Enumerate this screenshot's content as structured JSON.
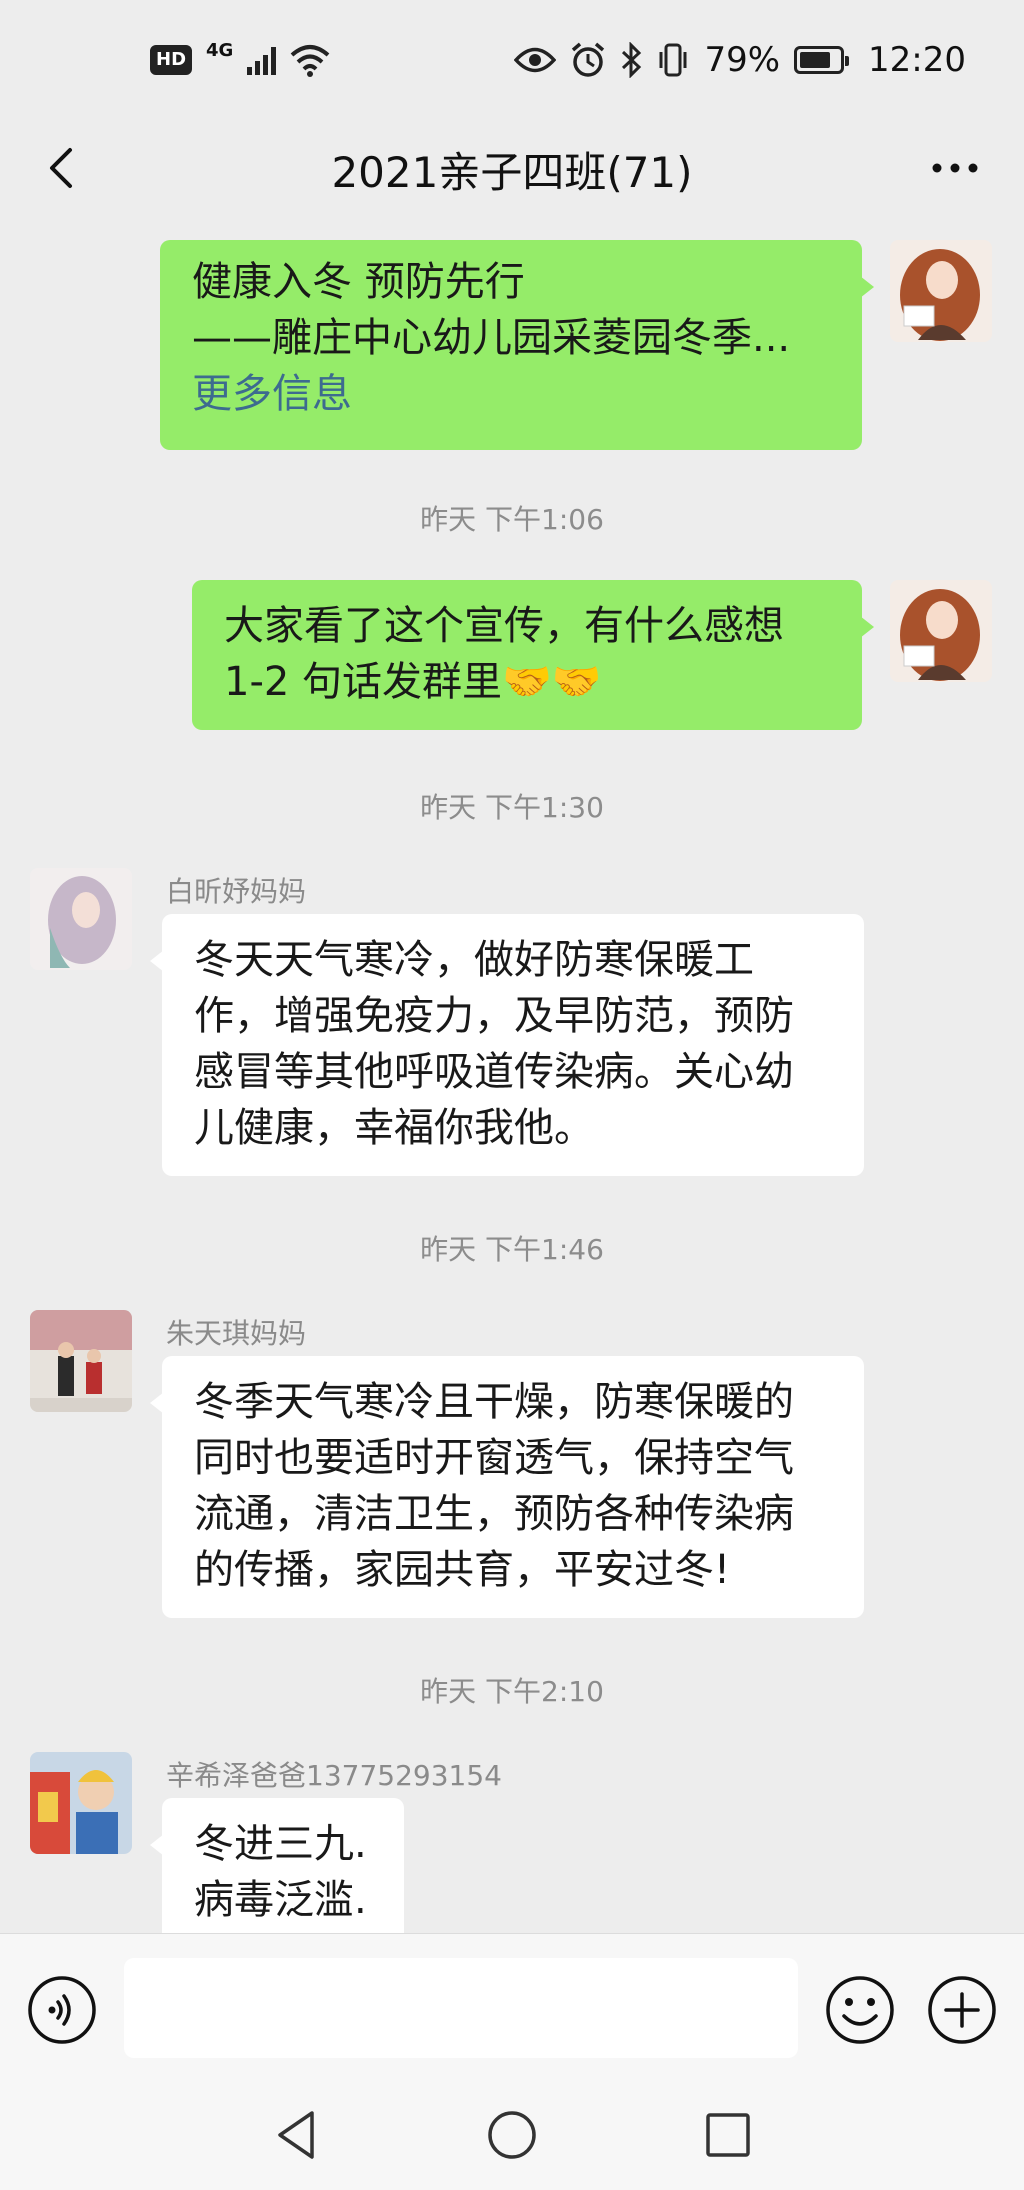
{
  "status_bar": {
    "hd": "HD",
    "network": "4G",
    "battery_text": "79%",
    "battery_level": 0.79,
    "time": "12:20",
    "icons": [
      "hd-icon",
      "signal-icon",
      "wifi-icon",
      "eye-icon",
      "alarm-icon",
      "bluetooth-icon",
      "vibrate-icon",
      "battery-icon"
    ]
  },
  "header": {
    "title": "2021亲子四班(71)",
    "back_icon": "chevron-left-icon",
    "more_icon": "more-dots-icon"
  },
  "messages": [
    {
      "type": "link-card",
      "side": "right",
      "lines": [
        "健康入冬  预防先行",
        "——雕庄中心幼儿园采菱园冬季..."
      ],
      "more_label": "更多信息"
    },
    {
      "type": "time",
      "text": "昨天 下午1:06"
    },
    {
      "type": "text",
      "side": "right",
      "lines": [
        "大家看了这个宣传，有什么感想",
        "1-2 句话发群里🤝🤝"
      ]
    },
    {
      "type": "time",
      "text": "昨天 下午1:30"
    },
    {
      "type": "text",
      "side": "left",
      "sender": "白昕妤妈妈",
      "lines": [
        "冬天天气寒冷，做好防寒保暖工",
        "作，增强免疫力，及早防范，预防",
        "感冒等其他呼吸道传染病。关心幼",
        "儿健康，幸福你我他。"
      ]
    },
    {
      "type": "time",
      "text": "昨天 下午1:46"
    },
    {
      "type": "text",
      "side": "left",
      "sender": "朱天琪妈妈",
      "lines": [
        "冬季天气寒冷且干燥，防寒保暖的",
        "同时也要适时开窗透气，保持空气",
        "流通，清洁卫生，预防各种传染病",
        "的传播，家园共育，平安过冬!"
      ]
    },
    {
      "type": "time",
      "text": "昨天 下午2:10"
    },
    {
      "type": "text",
      "side": "left",
      "sender": "辛希泽爸爸13775293154",
      "lines": [
        "冬进三九.",
        "病毒泛滥."
      ]
    }
  ],
  "input_bar": {
    "value": "",
    "icons": [
      "voice-icon",
      "emoji-icon",
      "plus-icon"
    ]
  },
  "nav_bar": {
    "icons": [
      "nav-back-icon",
      "nav-home-icon",
      "nav-recent-icon"
    ]
  },
  "colors": {
    "background": "#ededed",
    "my_bubble": "#95ec69",
    "other_bubble": "#ffffff",
    "link": "#3d6b8f",
    "meta_text": "#8c8c8c"
  }
}
